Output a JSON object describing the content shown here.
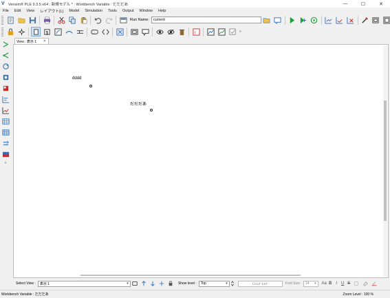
{
  "window": {
    "title": "Vensim® PLE 9.3.5 x64 : 新規モデル * : Workbench Variable : だだだあ",
    "app_icon_letter": "V",
    "controls": {
      "minimize": "—",
      "maximize": "☐",
      "close": "✕"
    }
  },
  "menu": [
    "File",
    "Edit",
    "View",
    "レイアウト(L)",
    "Model",
    "Simulation",
    "Tools",
    "Output",
    "Window",
    "Help"
  ],
  "toolbar": {
    "run_name_label": "Run Name:",
    "run_name_value": "current",
    "overflow": "»"
  },
  "view_tab": {
    "label": "View : 表示 1",
    "close": "✕"
  },
  "canvas": {
    "variables": [
      {
        "name": "dddd"
      },
      {
        "name": "だだだあ"
      }
    ]
  },
  "bottom_bar": {
    "select_view_label": "Select View :",
    "select_view_value": "表示 1",
    "show_level_label": "Show level :",
    "show_level_value": "Top",
    "font_name": "Courier",
    "font_size_label": "Font Size :",
    "font_size_value": "14",
    "format_buttons": [
      "Aa",
      "B",
      "I",
      "U",
      "S"
    ]
  },
  "status": {
    "left": "Workbench Variable : だだだあ",
    "right": "Zoom Level : 100 %"
  },
  "colors": {
    "accent_green": "#1e9e3c",
    "accent_blue": "#2a6fc0",
    "accent_red": "#d62626"
  }
}
